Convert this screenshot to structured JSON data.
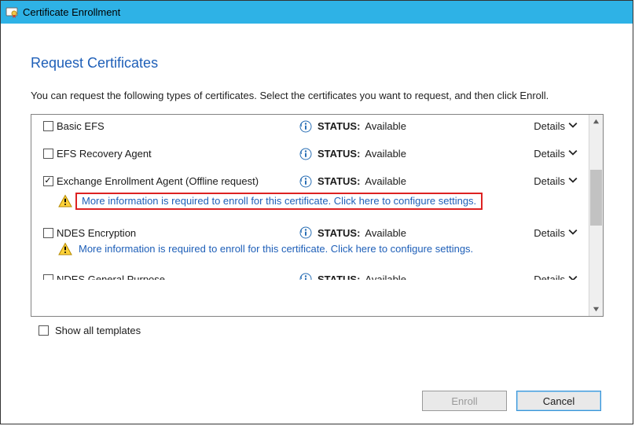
{
  "window": {
    "title": "Certificate Enrollment"
  },
  "page": {
    "heading": "Request Certificates",
    "description": "You can request the following types of certificates. Select the certificates you want to request, and then click Enroll."
  },
  "certificates": [
    {
      "name": "Basic EFS",
      "checked": false,
      "status_label": "STATUS:",
      "status_value": "Available",
      "details_label": "Details",
      "has_warning": false,
      "highlight": false
    },
    {
      "name": "EFS Recovery Agent",
      "checked": false,
      "status_label": "STATUS:",
      "status_value": "Available",
      "details_label": "Details",
      "has_warning": false,
      "highlight": false
    },
    {
      "name": "Exchange Enrollment Agent (Offline request)",
      "checked": true,
      "status_label": "STATUS:",
      "status_value": "Available",
      "details_label": "Details",
      "has_warning": true,
      "highlight": true
    },
    {
      "name": "NDES Encryption",
      "checked": false,
      "status_label": "STATUS:",
      "status_value": "Available",
      "details_label": "Details",
      "has_warning": true,
      "highlight": false
    },
    {
      "name": "NDES General Purpose",
      "checked": false,
      "status_label": "STATUS:",
      "status_value": "Available",
      "details_label": "Details",
      "has_warning": false,
      "highlight": false
    }
  ],
  "warning_link_text": "More information is required to enroll for this certificate. Click here to configure settings.",
  "show_all": {
    "label": "Show all templates",
    "checked": false
  },
  "footer": {
    "enroll": "Enroll",
    "cancel": "Cancel"
  },
  "scroll": {
    "thumb_top_pct": 24,
    "thumb_height_pct": 32
  }
}
